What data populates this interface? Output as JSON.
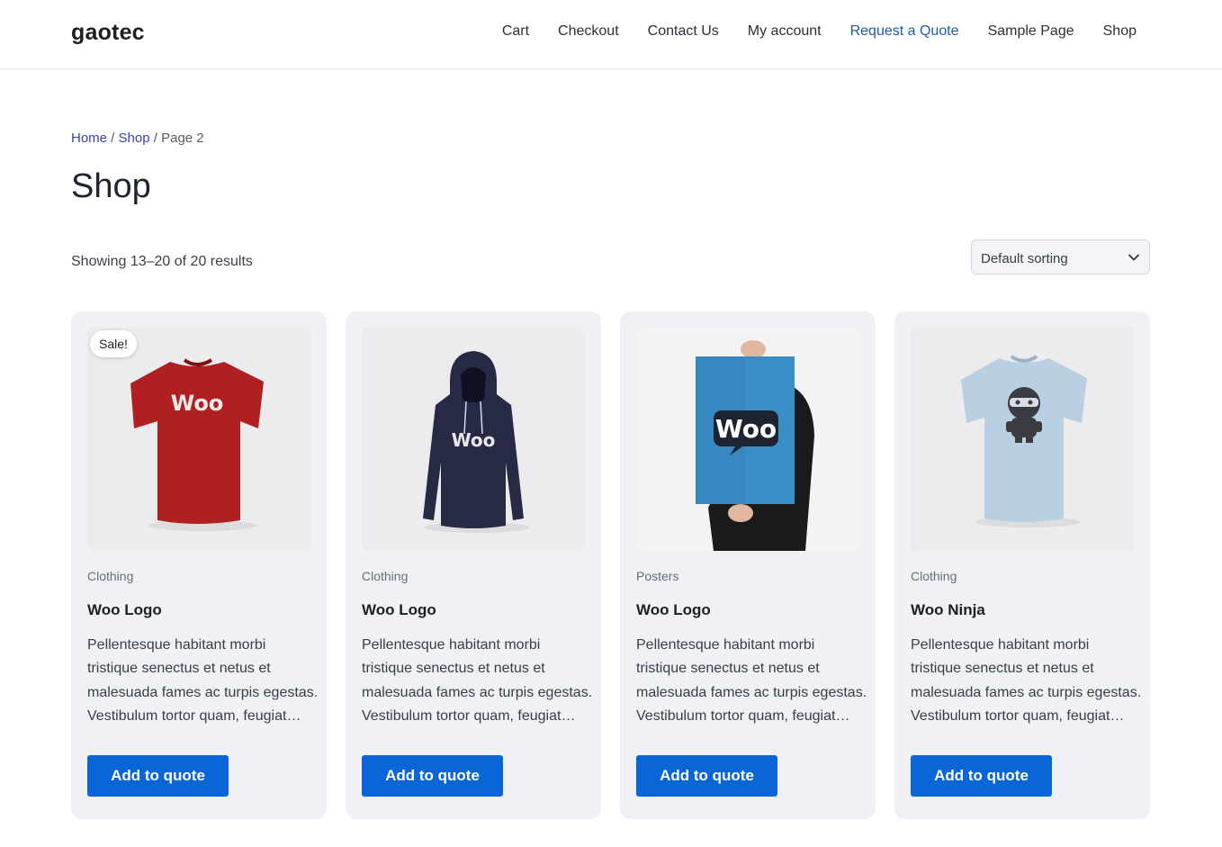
{
  "site": {
    "title": "gaotec"
  },
  "nav": {
    "items": [
      {
        "label": "Cart"
      },
      {
        "label": "Checkout"
      },
      {
        "label": "Contact Us"
      },
      {
        "label": "My account"
      },
      {
        "label": "Request a Quote",
        "active": true
      },
      {
        "label": "Sample Page"
      },
      {
        "label": "Shop"
      }
    ]
  },
  "breadcrumb": {
    "home": "Home",
    "sep": " / ",
    "shop": "Shop",
    "current": "Page 2"
  },
  "page": {
    "title": "Shop",
    "result_count": "Showing 13–20 of 20 results",
    "sorting": "Default sorting"
  },
  "products": [
    {
      "badge": "Sale!",
      "category": "Clothing",
      "title": "Woo Logo",
      "description": "Pellentesque habitant morbi tristique senectus et netus et malesuada fames ac turpis egestas. Vestibulum tortor quam, feugiat…",
      "button": "Add to quote",
      "image_icon": "red-tshirt-woo",
      "image_text": "Woo"
    },
    {
      "category": "Clothing",
      "title": "Woo Logo",
      "description": "Pellentesque habitant morbi tristique senectus et netus et malesuada fames ac turpis egestas. Vestibulum tortor quam, feugiat…",
      "button": "Add to quote",
      "image_icon": "navy-hoodie-woo",
      "image_text": "Woo"
    },
    {
      "category": "Posters",
      "title": "Woo Logo",
      "description": "Pellentesque habitant morbi tristique senectus et netus et malesuada fames ac turpis egestas. Vestibulum tortor quam, feugiat…",
      "button": "Add to quote",
      "image_icon": "blue-poster-woo",
      "image_text": "Woo"
    },
    {
      "category": "Clothing",
      "title": "Woo Ninja",
      "description": "Pellentesque habitant morbi tristique senectus et netus et malesuada fames ac turpis egestas. Vestibulum tortor quam, feugiat…",
      "button": "Add to quote",
      "image_icon": "lightblue-tshirt-ninja"
    }
  ],
  "colors": {
    "accent": "#0a66d6",
    "link": "#3b3db8",
    "card_bg": "#eff1f6",
    "tshirt_red": "#b01f22",
    "hoodie_navy": "#262a45",
    "poster_blue": "#3a8ec6",
    "tshirt_lightblue": "#b9d0e3"
  }
}
